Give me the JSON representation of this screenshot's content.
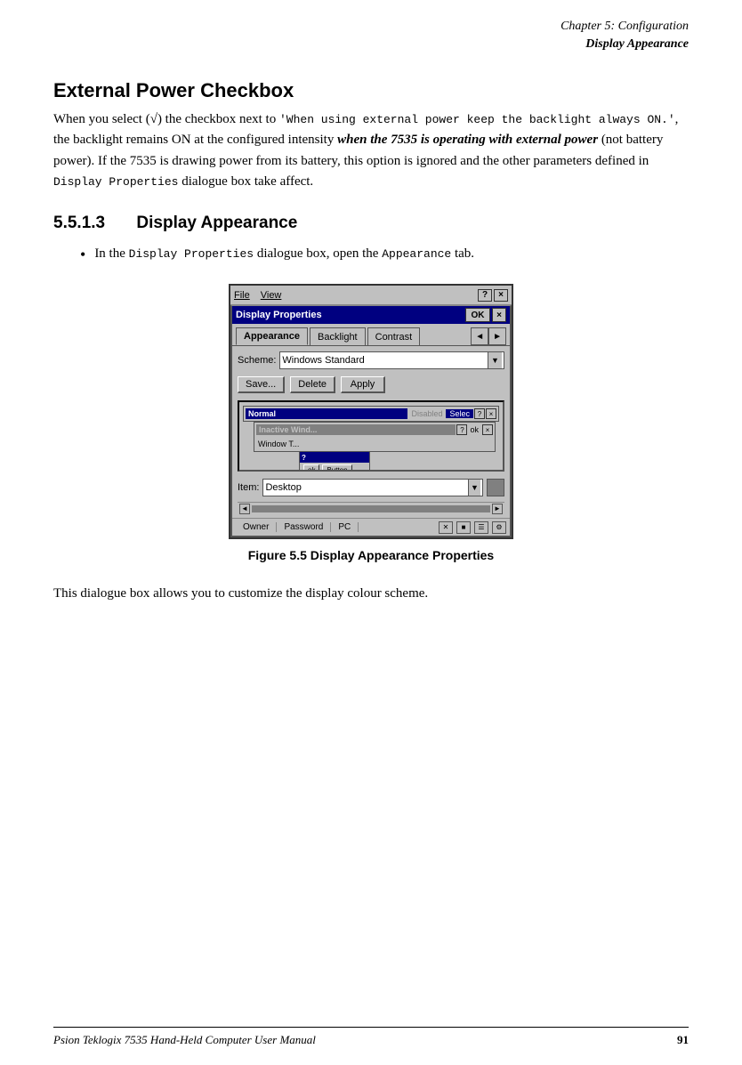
{
  "header": {
    "chapter_line": "Chapter  5:  Configuration",
    "section_line": "Display Appearance"
  },
  "external_power": {
    "title": "External  Power  Checkbox",
    "paragraph1": "When you select (√) the checkbox next to ",
    "mono_text": "'When  using  external  power  keep  the  backlight  always  ON.'",
    "paragraph2": ", the backlight remains ON at the configured intensity ",
    "bold_italic_text": "when the 7535 is operating with external power",
    "paragraph3": " (not battery power). If the 7535 is drawing power from its battery, this option is ignored and the other parameters defined in ",
    "mono_text2": "Display Properties",
    "paragraph4": " dialogue box take affect."
  },
  "section_513": {
    "number": "5.5.1.3",
    "title": "Display  Appearance",
    "bullet_text1": "In the ",
    "bullet_mono": "Display  Properties",
    "bullet_text2": " dialogue box, open the ",
    "bullet_mono2": "Appearance",
    "bullet_text3": " tab."
  },
  "figure": {
    "caption": "Figure  5.5  Display  Appearance  Properties",
    "dialog": {
      "menu_file": "File",
      "menu_view": "View",
      "help_btn": "?",
      "close_btn": "×",
      "title": "Display Properties",
      "ok_btn": "OK",
      "tabs": {
        "appearance": "Appearance",
        "backlight": "Backlight",
        "contrast": "Contrast"
      },
      "scheme_label": "Scheme:",
      "scheme_value": "Windows Standard",
      "save_btn": "Save...",
      "delete_btn": "Delete",
      "apply_btn": "Apply",
      "preview": {
        "normal_label": "Normal",
        "disabled_label": "Disabled",
        "selected_label": "Selec",
        "inactive_label": "Inactive Wind...",
        "ok_label": "ok",
        "window_text": "Window T...",
        "msg_title": "?",
        "msg_btn1": "ok",
        "msg_btn2": "Button"
      },
      "item_label": "Item:",
      "item_value": "Desktop",
      "status": {
        "owner": "Owner",
        "password": "Password",
        "pc": "PC"
      }
    }
  },
  "closing_paragraph": "This dialogue box allows you to customize the display colour scheme.",
  "footer": {
    "left": "Psion Teklogix 7535 Hand-Held Computer User Manual",
    "right": "91"
  }
}
